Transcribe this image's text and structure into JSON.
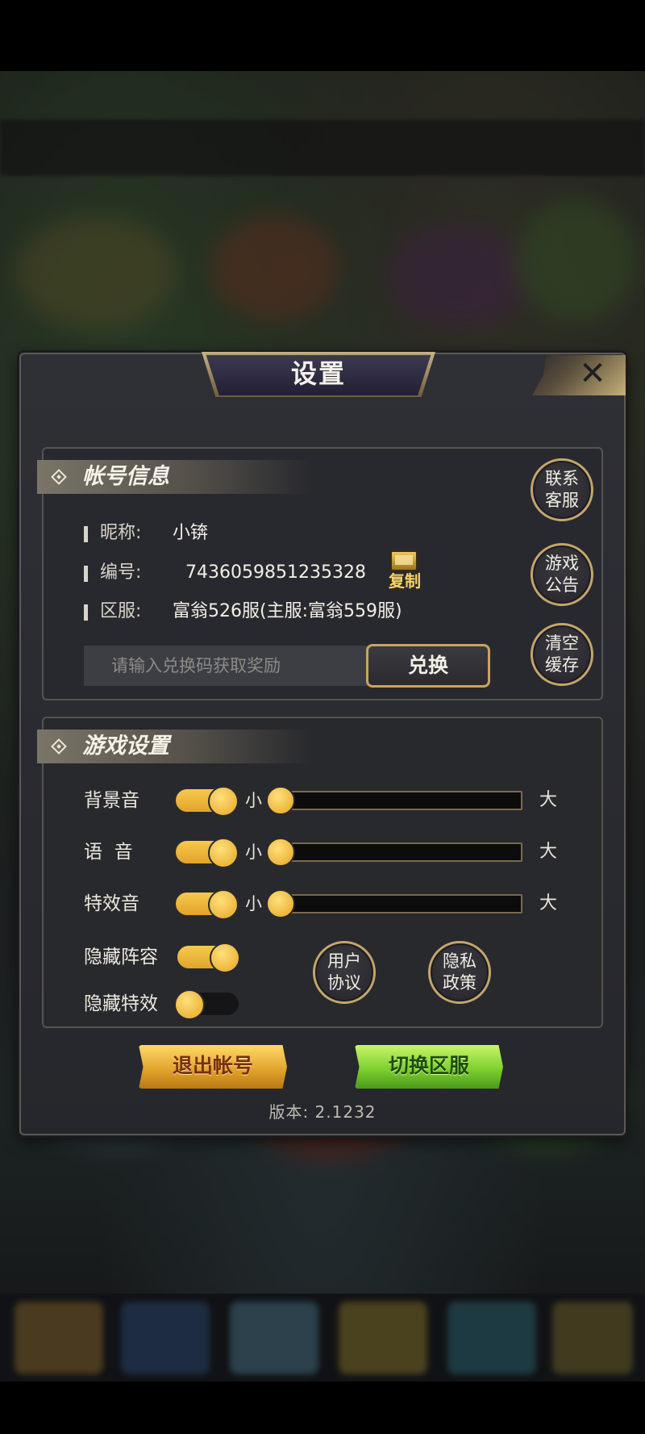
{
  "dialog": {
    "title": "设置",
    "close_glyph": "✕"
  },
  "account": {
    "section_title": "帐号信息",
    "nickname_label": "昵称:",
    "nickname_value": "小锛",
    "id_label": "编号:",
    "id_value": "7436059851235328",
    "copy_label": "复制",
    "server_label": "区服:",
    "server_value": "富翁526服(主服:富翁559服)",
    "redeem_placeholder": "请输入兑换码获取奖励",
    "redeem_button": "兑换"
  },
  "side_buttons": [
    {
      "line1": "联系",
      "line2": "客服"
    },
    {
      "line1": "游戏",
      "line2": "公告"
    },
    {
      "line1": "清空",
      "line2": "缓存"
    }
  ],
  "game_settings": {
    "section_title": "游戏设置",
    "small_label": "小",
    "big_label": "大",
    "rows": [
      {
        "label": "背景音",
        "toggle_on": true,
        "volume": 0
      },
      {
        "label": "语  音",
        "toggle_on": true,
        "volume": 0
      },
      {
        "label": "特效音",
        "toggle_on": true,
        "volume": 0
      }
    ],
    "hide_lineup": {
      "label": "隐藏阵容",
      "toggle_on": true
    },
    "hide_effects": {
      "label": "隐藏特效",
      "toggle_on": false
    },
    "user_agreement": {
      "line1": "用户",
      "line2": "协议"
    },
    "privacy_policy": {
      "line1": "隐私",
      "line2": "政策"
    }
  },
  "actions": {
    "logout": "退出帐号",
    "switch_server": "切换区服"
  },
  "version": "版本: 2.1232",
  "colors": {
    "gold_accent": "#c8a461",
    "toggle_on": "#f7c94d",
    "logout_btn": "#e0a12a",
    "switch_btn": "#7ed12f"
  },
  "icons": [
    "close-icon",
    "copy-icon",
    "diamond-bullet-icon"
  ]
}
